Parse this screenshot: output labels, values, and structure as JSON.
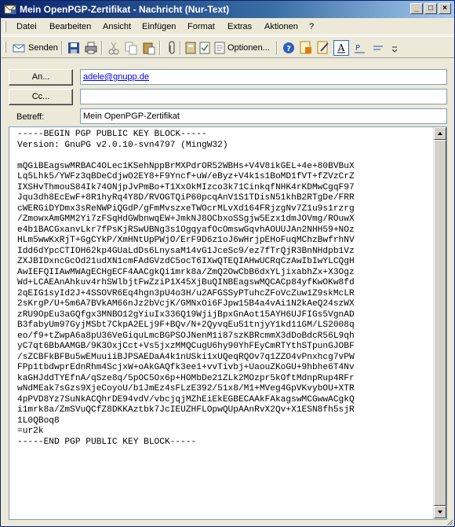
{
  "window": {
    "title": "Mein OpenPGP-Zertifikat - Nachricht (Nur-Text)",
    "minimize_label": "_",
    "maximize_label": "□",
    "close_label": "×"
  },
  "menubar": {
    "items": [
      {
        "label": "Datei"
      },
      {
        "label": "Bearbeiten"
      },
      {
        "label": "Ansicht"
      },
      {
        "label": "Einfügen"
      },
      {
        "label": "Format"
      },
      {
        "label": "Extras"
      },
      {
        "label": "Aktionen"
      },
      {
        "label": "?"
      }
    ]
  },
  "toolbar": {
    "send_label": "Senden",
    "options_label": "Optionen..."
  },
  "header": {
    "to_button": "An...",
    "to_value": "adele@gnupp.de",
    "cc_button": "Cc...",
    "cc_value": "",
    "subject_label": "Betreff:",
    "subject_value": "Mein OpenPGP-Zertifikat"
  },
  "message": {
    "body": "-----BEGIN PGP PUBLIC KEY BLOCK-----\nVersion: GnuPG v2.0.10-svn4797 (MingW32)\n\nmQGiBEagswMRBAC4OLec1KSehNppBrMXPdrOR52WBHs+V4V8ikGEL+4e+80BVBuX\nLq5Lhk5/YWFz3qBDeCdjwO2EY8+F9Yncf+uW/eByz+V4k1s1BoMD1fVT+fZVzCrZ\nIXSHvThmouS84Ik74ONjpJvPmBo+T1XxOkMIzco3k71CinkqfNHK4rKDMwCgqF97\nJqu3dh8EcEwF+8R1hyRq4Y8D/RVOGTQiP60pcqAnV1S1TDisN51khB2RTgDe/FRR\ncWERGiDYDmx3sReNWPiQGdP/gFmMvszxeTWOcrMLvXd164FRjzgNv7Z1u9s1rzrg\n/ZmowxAmGMM2Yi7zFSqHdGWbnwqEW+JmkNJ8OCbxoSSgjw5Ezx1dmJOVmg/ROuwX\ne4b1BACGxanvLkr7fPsKjRSwUBNg3s1OgqyafOcOmswGqvhAOUUJAn2NHH59+NOz\nHLm5wwKxRjT+GgCYkP/XmHNtUpPWjO/ErF9D6z1oJ6wHrjpEHoFuqMChzBwfrhNV\nIdd6dYpcCTIOH62kp4GUaLdDs6LnysaM14vG1JceSc9/ez7fTrQjR3BnNHdpb1Vz\nZXJBIDxncGcOd21udXN1cmFAdGVzdC5ocT6IXwQTEQIAHwUCRqCzAwIbIwYLCQgH\nAwIEFQIIAwMWAgECHgECF4AACgkQi1mrk8a/ZmQ2OwCbB6dxYLjixabhZx+X3Ogz\nWd+LCAEAnAhkuv4rhSWlbjtFwZziP1X45XjBuQINBEagswMQCACp84yfKwOKw8fd\n2qEIG1syId2J+4SSOVR6Eq4hgn3pU4o3H/u2AFGSSyPTuhcZFoVcZuw1Z9skMcLR\n2sKrgP/U+5m6A7BVkAM66nJz2bVcjK/GMNxOi6FJpw15B4a4vAi1N2kAeQ24szWX\nzRU9OpEu3aGQfgx3MNBO12gYiuIx336Q19WjijBpxGnAot15AYH6UJFIGs5VgnAD\nB3fabyUm97GyjMSbt7CkpA2ELj9F+BQv/N+2QyvqEu51tnjyY1kd11GM/LS2008q\neo/f9+tZwpA6a8pU36VeGiquLmcBGPSOJNenM1i87szKBRcmmX3dDoBdcR56L9qh\nyC7qt6BbAAMGB/9K3OxjCct+Vs5jxzMMQCugU6hy90YhFEyCmRTYthSTpunGJOBF\n/sZCBFkBFBu5wEMuuiiBJPSAEDaA4k1nUSki1xUQeqRQOv7q1ZZO4vPnxhcg7vPW\nFPp1tbdwprEdnRhm4ScjxW+oAkGAQfk3ee1+vvTivbj+UaouZKoGU+9hbhe6T4Nv\nkaGHJddTYEfnA/qSze8q/5pOC5Ox6p+HOMbDe21ZLk2MOzpr5kOftMdnpRup4RFr\nwNdMEak7sGzs9XjeCoyoU/b1JmEz4sFLzE392/51x8/M1+MVeg4GpVKvybOU+XTR\n4pPVD8Yz7SuNkACQhrDE94vdV/vbcjqjMZhEiEkEGBECAAkFAkagswMCGwwACgkQ\ni1mrk8a/ZmSVuQCfZ8DKKAztbk7JcIEUZHFLOpwQUpAAnRvX2Qv+X1ESN8fh5sjR\n1L0QBoq8\n=ur2k\n-----END PGP PUBLIC KEY BLOCK-----"
  },
  "colors": {
    "title_start": "#0a246a",
    "title_end": "#a6caf0",
    "face": "#ece9d8",
    "link": "#0000ee"
  }
}
